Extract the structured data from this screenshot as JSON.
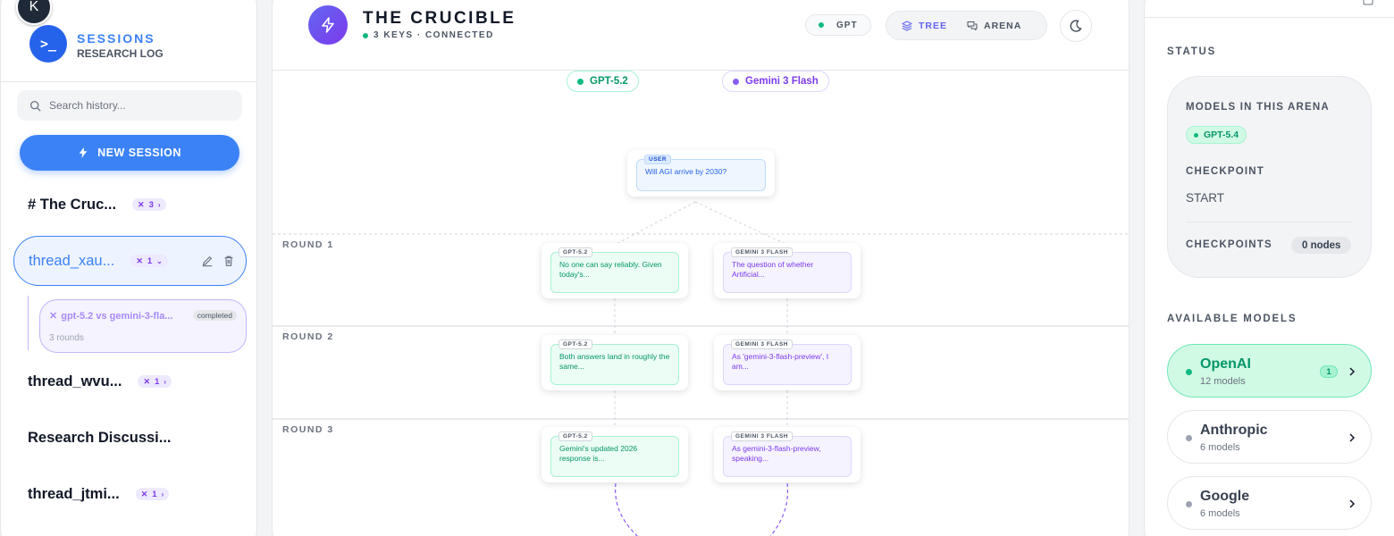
{
  "user": {
    "avatar_initial": "K"
  },
  "sidebar": {
    "brand_title": "SESSIONS",
    "brand_subtitle": "RESEARCH LOG",
    "search_placeholder": "Search history...",
    "new_session_label": "NEW SESSION",
    "threads": [
      {
        "label": "# The Cruc...",
        "badge_count": "3",
        "active": false
      },
      {
        "label": "thread_xau...",
        "badge_count": "1",
        "active": true,
        "sub": {
          "title": "gpt-5.2 vs gemini-3-fla...",
          "status": "completed",
          "rounds": "3 rounds"
        }
      },
      {
        "label": "thread_wvu...",
        "badge_count": "1",
        "active": false
      },
      {
        "label": "Research Discussi...",
        "badge_count": "",
        "active": false
      },
      {
        "label": "thread_jtmi...",
        "badge_count": "1",
        "active": false
      }
    ]
  },
  "header": {
    "title": "THE CRUCIBLE",
    "connection": "3 KEYS · CONNECTED",
    "provider_pill": "GPT",
    "views": [
      {
        "label": "TREE",
        "active": true
      },
      {
        "label": "ARENA",
        "active": false
      }
    ],
    "theme_icon": "moon-icon"
  },
  "canvas": {
    "models": [
      {
        "name": "GPT-5.2",
        "color": "#10b981"
      },
      {
        "name": "Gemini 3 Flash",
        "color": "#8b5cf6"
      }
    ],
    "user_node": {
      "tag": "USER",
      "text": "Will AGI arrive by 2030?"
    },
    "rounds": [
      {
        "label": "ROUND 1",
        "gpt": {
          "tag": "GPT-5.2",
          "text": "No one can say reliably. Given today's..."
        },
        "gemini": {
          "tag": "GEMINI 3 FLASH",
          "text": "The question of whether Artificial..."
        }
      },
      {
        "label": "ROUND 2",
        "gpt": {
          "tag": "GPT-5.2",
          "text": "Both answers land in roughly the same..."
        },
        "gemini": {
          "tag": "GEMINI 3 FLASH",
          "text": "As 'gemini-3-flash-preview', I am..."
        }
      },
      {
        "label": "ROUND 3",
        "gpt": {
          "tag": "GPT-5.2",
          "text": "Gemini's updated 2026 response is..."
        },
        "gemini": {
          "tag": "GEMINI 3 FLASH",
          "text": "As gemini-3-flash-preview, speaking..."
        }
      }
    ]
  },
  "status_panel": {
    "section_label": "STATUS",
    "models_label": "MODELS IN THIS ARENA",
    "arena_model": "GPT-5.4",
    "checkpoint_label": "CHECKPOINT",
    "checkpoint_value": "START",
    "checkpoints_label": "CHECKPOINTS",
    "checkpoints_value": "0 nodes"
  },
  "available_models": {
    "section_label": "AVAILABLE MODELS",
    "providers": [
      {
        "name": "OpenAI",
        "count": "12 models",
        "badge": "1",
        "selected": true
      },
      {
        "name": "Anthropic",
        "count": "6 models",
        "badge": "",
        "selected": false
      },
      {
        "name": "Google",
        "count": "6 models",
        "badge": "",
        "selected": false
      }
    ]
  },
  "colors": {
    "accent_blue": "#3b82f6",
    "gpt_green": "#10b981",
    "gemini_purple": "#8b5cf6",
    "brand_indigo": "#6366f1"
  }
}
